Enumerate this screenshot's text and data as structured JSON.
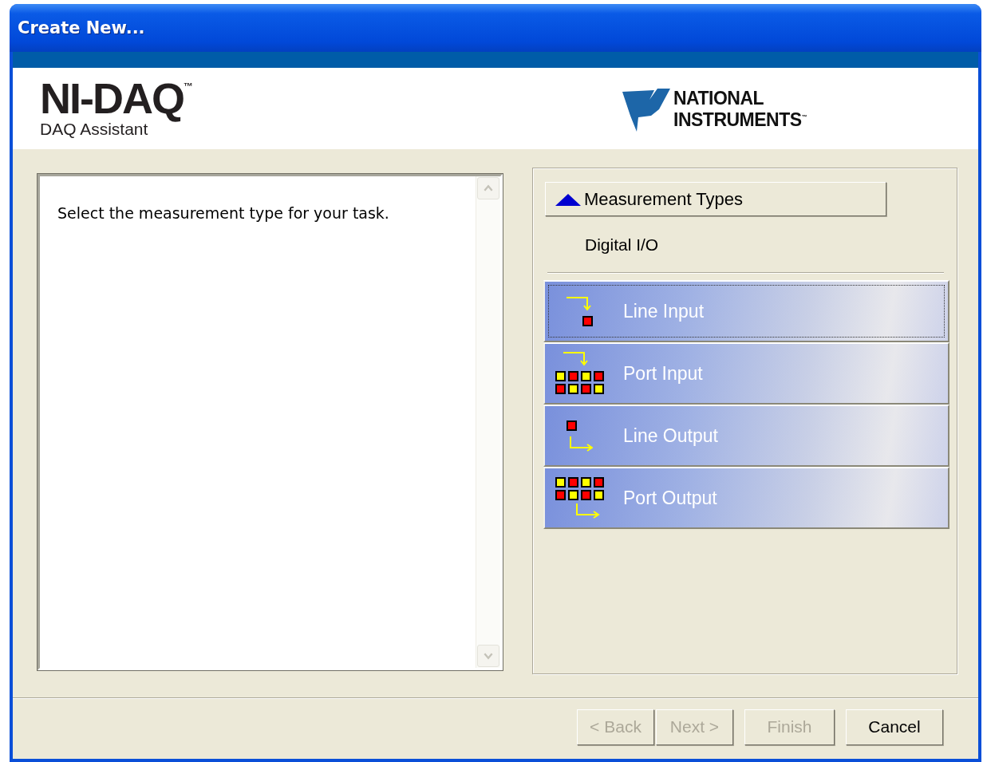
{
  "window": {
    "title": "Create New..."
  },
  "header": {
    "product": "NI-DAQ$^{™}$",
    "subtitle": "DAQ Assistant",
    "vendor_lines": [
      "NATIONAL",
      "INSTRUMENTS$^{™}$"
    ]
  },
  "help_text": "Select the measurement type for your task.",
  "measurement_types": {
    "button": "Measurement Types",
    "expanded": true,
    "category": "Digital I/O",
    "items": [
      {
        "kind": "line-input",
        "label": "Line Input",
        "focused": true
      },
      {
        "kind": "port-input",
        "label": "Port Input",
        "focused": false
      },
      {
        "kind": "line-output",
        "label": "Line Output",
        "focused": false
      },
      {
        "kind": "port-output",
        "label": "Port Output",
        "focused": false
      }
    ]
  },
  "buttons": [
    {
      "label": "< Back",
      "disabled": true
    },
    {
      "label": "Next >",
      "disabled": true
    },
    {
      "label": "Finish",
      "disabled": true
    },
    {
      "label": "Cancel",
      "disabled": false
    }
  ]
}
